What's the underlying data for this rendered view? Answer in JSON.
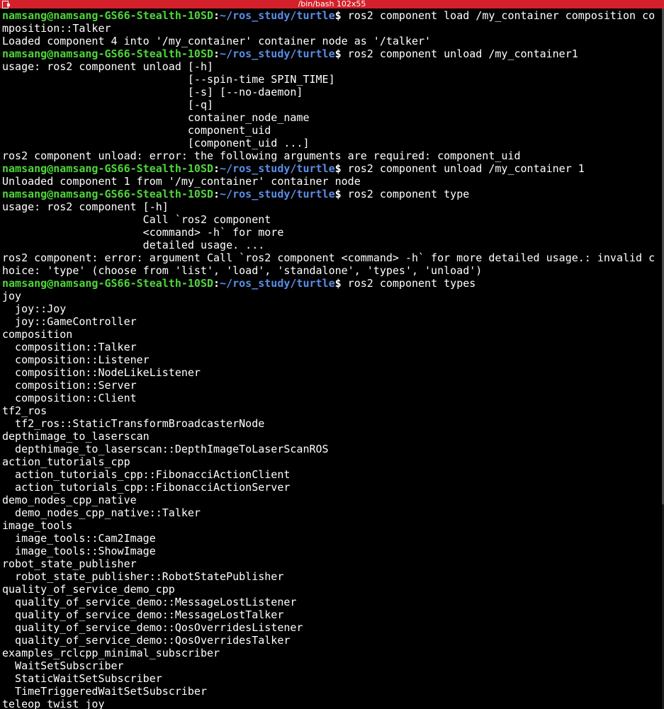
{
  "window": {
    "title": "/bin/bash 102x55",
    "titlebar_color": "#d4202a",
    "icon": "terminal-window-icon"
  },
  "colors": {
    "background": "#000000",
    "text": "#ffffff",
    "prompt_user": "#4fd63a",
    "prompt_path": "#5a8ee6"
  },
  "prompt": {
    "user": "namsang@namsang-GS66-Stealth-10SD",
    "sep": ":",
    "path": "~/ros_study/turtle",
    "sign": "$ "
  },
  "lines": [
    {
      "type": "prompt",
      "cmd": "ros2 component load /my_container composition co"
    },
    {
      "type": "out",
      "text": "mposition::Talker"
    },
    {
      "type": "out",
      "text": "Loaded component 4 into '/my_container' container node as '/talker'"
    },
    {
      "type": "prompt",
      "cmd": "ros2 component unload /my_container1"
    },
    {
      "type": "out",
      "text": "usage: ros2 component unload [-h]"
    },
    {
      "type": "out",
      "text": "                             [--spin-time SPIN_TIME]"
    },
    {
      "type": "out",
      "text": "                             [-s] [--no-daemon]"
    },
    {
      "type": "out",
      "text": "                             [-q]"
    },
    {
      "type": "out",
      "text": "                             container_node_name"
    },
    {
      "type": "out",
      "text": "                             component_uid"
    },
    {
      "type": "out",
      "text": "                             [component_uid ...]"
    },
    {
      "type": "out",
      "text": "ros2 component unload: error: the following arguments are required: component_uid"
    },
    {
      "type": "prompt",
      "cmd": "ros2 component unload /my_container 1"
    },
    {
      "type": "out",
      "text": "Unloaded component 1 from '/my_container' container node"
    },
    {
      "type": "prompt",
      "cmd": "ros2 component type"
    },
    {
      "type": "out",
      "text": "usage: ros2 component [-h]"
    },
    {
      "type": "out",
      "text": "                      Call `ros2 component"
    },
    {
      "type": "out",
      "text": "                      <command> -h` for more"
    },
    {
      "type": "out",
      "text": "                      detailed usage. ..."
    },
    {
      "type": "out",
      "text": "ros2 component: error: argument Call `ros2 component <command> -h` for more detailed usage.: invalid c"
    },
    {
      "type": "out",
      "text": "hoice: 'type' (choose from 'list', 'load', 'standalone', 'types', 'unload')"
    },
    {
      "type": "prompt",
      "cmd": "ros2 component types"
    },
    {
      "type": "out",
      "text": "joy"
    },
    {
      "type": "out",
      "text": "  joy::Joy"
    },
    {
      "type": "out",
      "text": "  joy::GameController"
    },
    {
      "type": "out",
      "text": "composition"
    },
    {
      "type": "out",
      "text": "  composition::Talker"
    },
    {
      "type": "out",
      "text": "  composition::Listener"
    },
    {
      "type": "out",
      "text": "  composition::NodeLikeListener"
    },
    {
      "type": "out",
      "text": "  composition::Server"
    },
    {
      "type": "out",
      "text": "  composition::Client"
    },
    {
      "type": "out",
      "text": "tf2_ros"
    },
    {
      "type": "out",
      "text": "  tf2_ros::StaticTransformBroadcasterNode"
    },
    {
      "type": "out",
      "text": "depthimage_to_laserscan"
    },
    {
      "type": "out",
      "text": "  depthimage_to_laserscan::DepthImageToLaserScanROS"
    },
    {
      "type": "out",
      "text": "action_tutorials_cpp"
    },
    {
      "type": "out",
      "text": "  action_tutorials_cpp::FibonacciActionClient"
    },
    {
      "type": "out",
      "text": "  action_tutorials_cpp::FibonacciActionServer"
    },
    {
      "type": "out",
      "text": "demo_nodes_cpp_native"
    },
    {
      "type": "out",
      "text": "  demo_nodes_cpp_native::Talker"
    },
    {
      "type": "out",
      "text": "image_tools"
    },
    {
      "type": "out",
      "text": "  image_tools::Cam2Image"
    },
    {
      "type": "out",
      "text": "  image_tools::ShowImage"
    },
    {
      "type": "out",
      "text": "robot_state_publisher"
    },
    {
      "type": "out",
      "text": "  robot_state_publisher::RobotStatePublisher"
    },
    {
      "type": "out",
      "text": "quality_of_service_demo_cpp"
    },
    {
      "type": "out",
      "text": "  quality_of_service_demo::MessageLostListener"
    },
    {
      "type": "out",
      "text": "  quality_of_service_demo::MessageLostTalker"
    },
    {
      "type": "out",
      "text": "  quality_of_service_demo::QosOverridesListener"
    },
    {
      "type": "out",
      "text": "  quality_of_service_demo::QosOverridesTalker"
    },
    {
      "type": "out",
      "text": "examples_rclcpp_minimal_subscriber"
    },
    {
      "type": "out",
      "text": "  WaitSetSubscriber"
    },
    {
      "type": "out",
      "text": "  StaticWaitSetSubscriber"
    },
    {
      "type": "out",
      "text": "  TimeTriggeredWaitSetSubscriber"
    },
    {
      "type": "out",
      "text": "teleop_twist_joy"
    }
  ]
}
